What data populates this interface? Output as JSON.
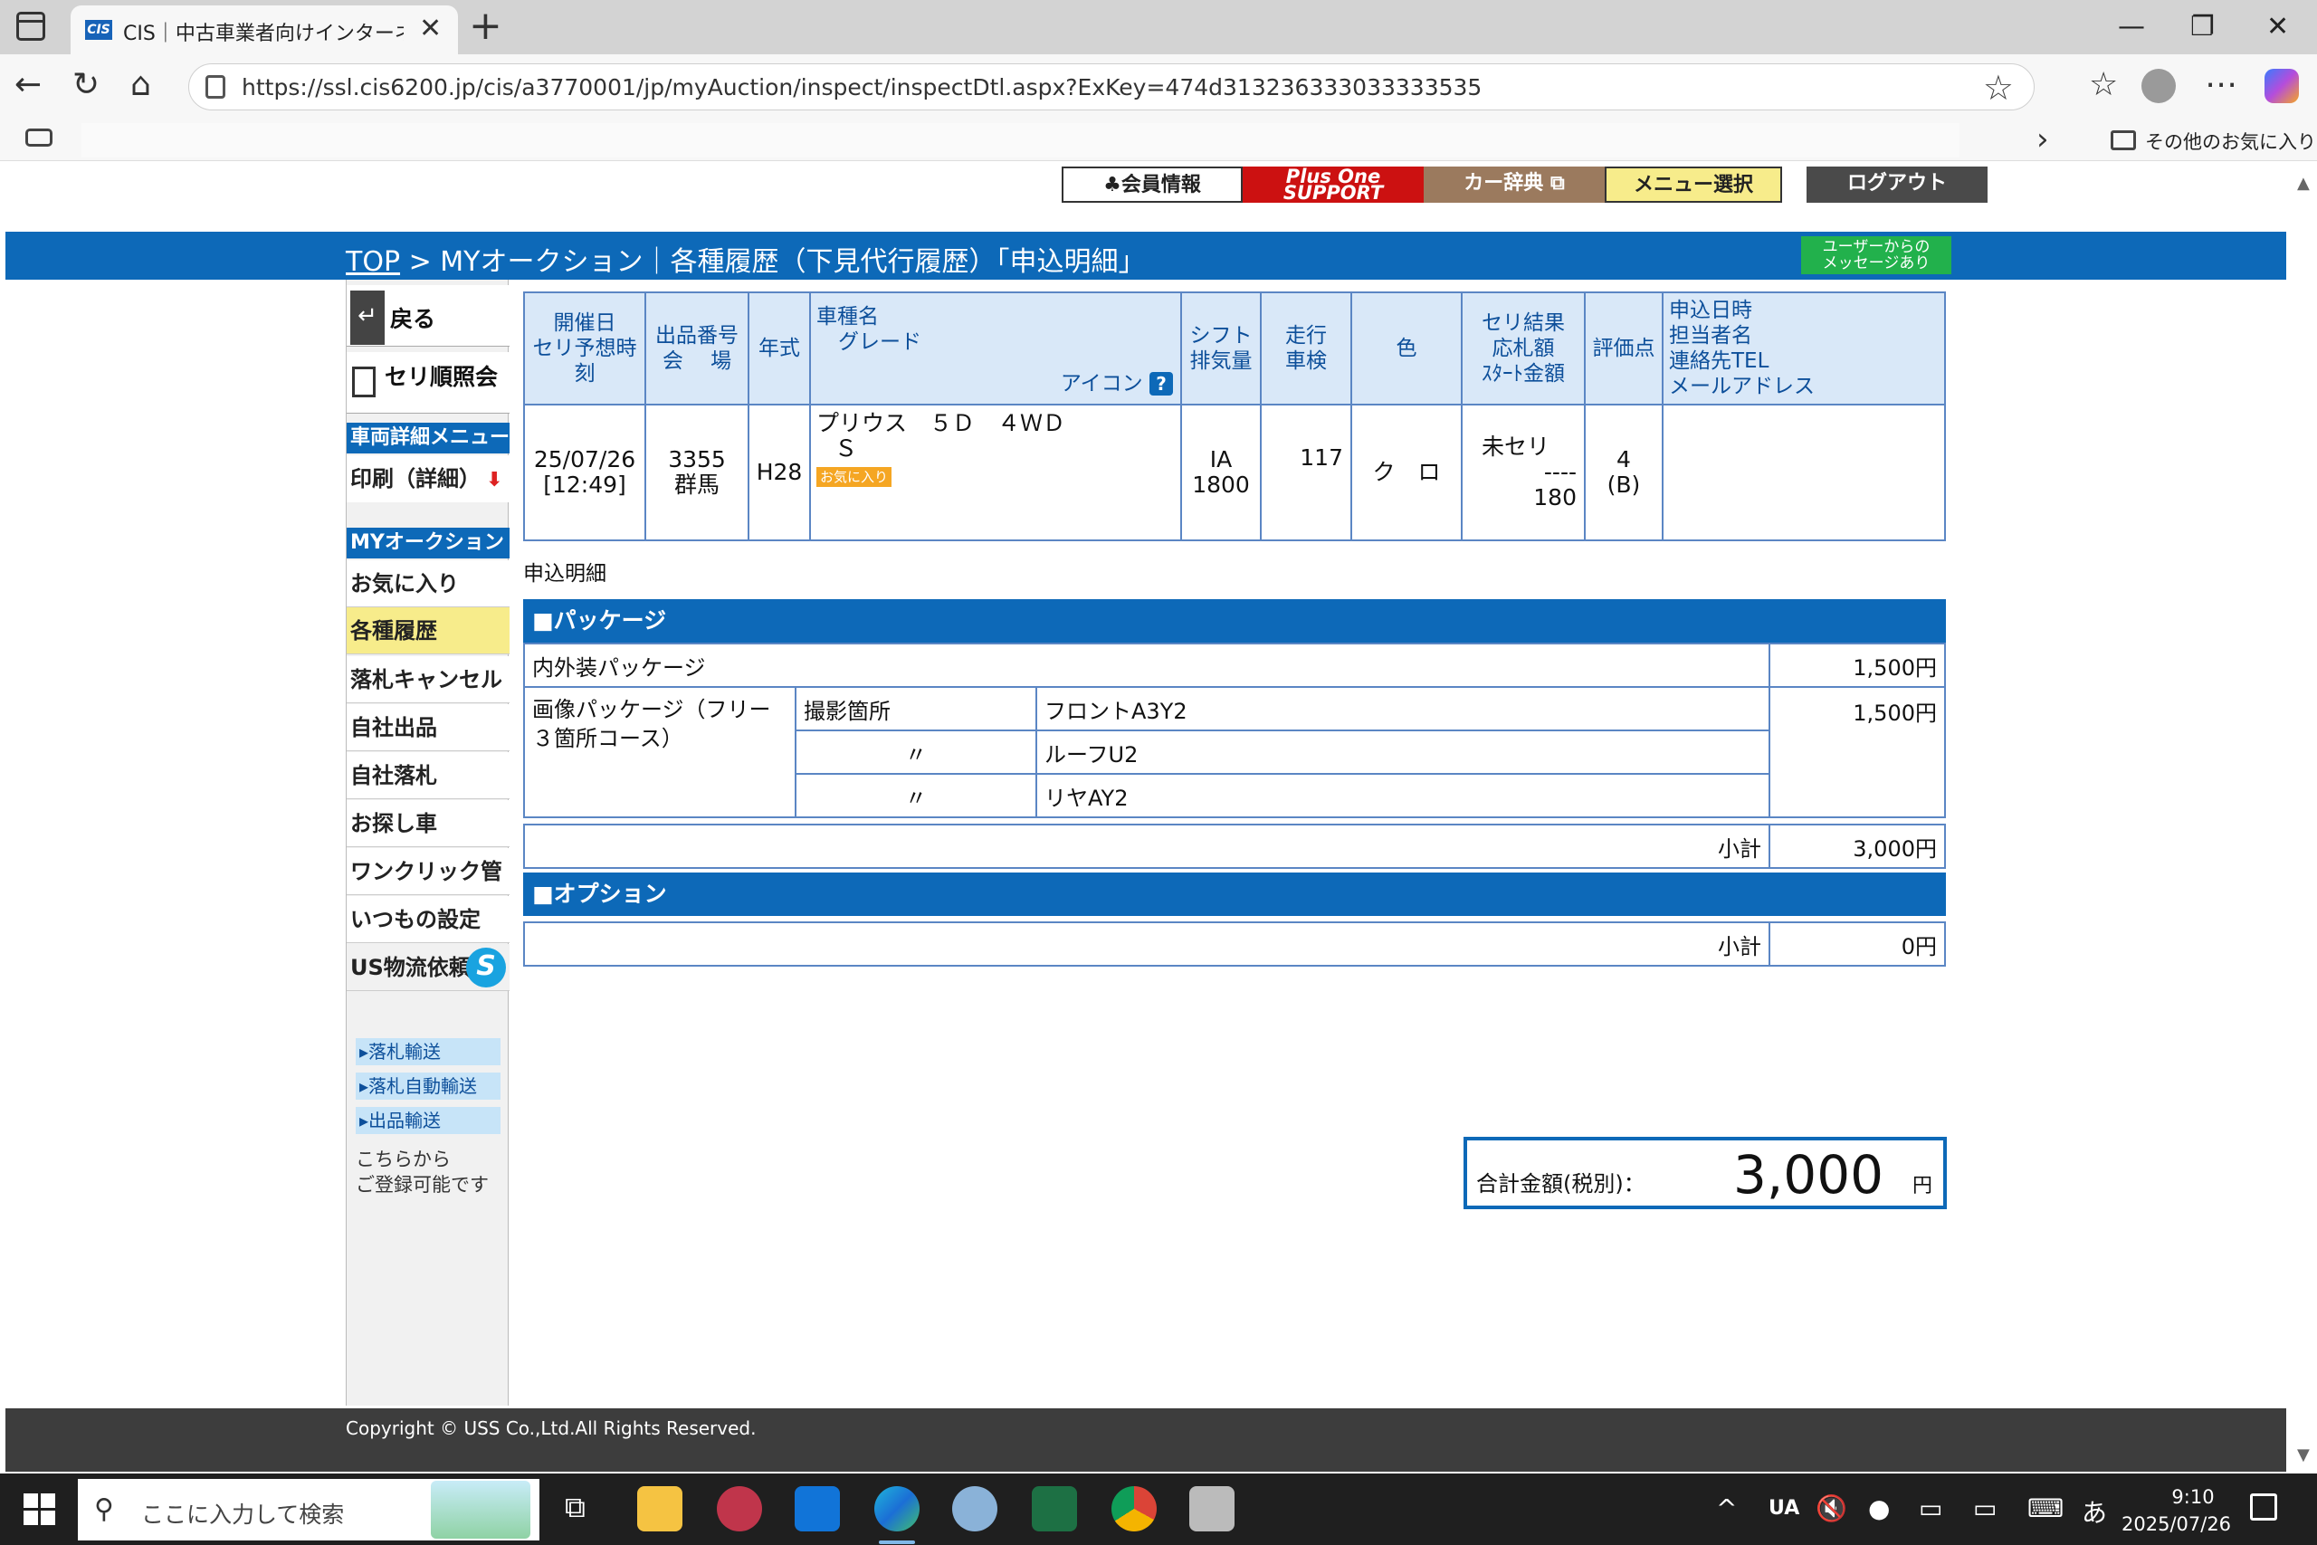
{
  "browser": {
    "tab_favicon": "CIS",
    "tab_title": "CIS｜中古車業者向けインターネット",
    "tab_close": "✕",
    "new_tab": "+",
    "url": "https://ssl.cis6200.jp/cis/a3770001/jp/myAuction/inspect/inspectDtl.aspx?ExKey=474d313236333033333535",
    "favorites_other": "その他のお気に入り",
    "icons": [
      "back-icon",
      "refresh-icon",
      "home-icon",
      "lock-icon",
      "star-icon",
      "favorites-icon",
      "profile-icon",
      "more-icon",
      "copilot-icon",
      "minimize-icon",
      "restore-icon",
      "close-icon"
    ]
  },
  "header": {
    "buttons": {
      "member": "会員情報",
      "plusone": "Plus One SUPPORT",
      "cardict": "カー辞典",
      "menu": "メニュー選択",
      "logout": "ログアウト"
    },
    "breadcrumb_top": "TOP",
    "breadcrumb_rest": " > MYオークション｜各種履歴（下見代行履歴）「申込明細」",
    "user_message": "ユーザーからの\nメッセージあり"
  },
  "sidebar": {
    "back": "戻る",
    "seri": "セリ順照会",
    "vehicle_menu_head": "車両詳細メニュー",
    "print": "印刷（詳細）",
    "myauction_head": "MYオークション",
    "items": [
      "お気に入り",
      "各種履歴",
      "落札キャンセル",
      "自社出品",
      "自社落札",
      "お探し車",
      "ワンクリック管理",
      "いつもの設定",
      "US物流依頼"
    ],
    "sub_items": [
      "落札輸送",
      "落札自動輸送",
      "出品輸送"
    ],
    "reg_note_1": "こちらから",
    "reg_note_2": "ご登録可能です"
  },
  "car_table": {
    "headers": {
      "date_1": "開催日",
      "date_2": "セリ予想時刻",
      "lot_1": "出品番号",
      "lot_2": "会　 場",
      "year": "年式",
      "name_1": "車種名",
      "name_2": "グレード",
      "icon": "アイコン",
      "shift_1": "シフト",
      "shift_2": "排気量",
      "mileage_1": "走行",
      "mileage_2": "車検",
      "color": "色",
      "result_1": "セリ結果",
      "result_2": "応札額",
      "result_3": "ｽﾀｰﾄ金額",
      "score": "評価点",
      "apply_1": "申込日時",
      "apply_2": "担当者名",
      "apply_3": "連絡先TEL",
      "apply_4": "メールアドレス"
    },
    "row": {
      "date": "25/07/26",
      "time": "[12:49]",
      "lot": "3355",
      "venue": "群馬",
      "year": "H28",
      "name": "プリウス　５Ｄ　４ＷＤ",
      "grade": "Ｓ",
      "fav_badge": "お気に入り",
      "shift": "IA",
      "displacement": "1800",
      "mileage": "117",
      "color": "ク　ロ",
      "result": "未セリ",
      "bid": "----",
      "start_price": "180",
      "score": "4",
      "score_sub": "(B)"
    }
  },
  "detail": {
    "label": "申込明細",
    "package_head": "■パッケージ",
    "interior_exterior": "内外装パッケージ",
    "interior_exterior_price": "1,500円",
    "image_package": "画像パッケージ（フリー３箇所コース）",
    "shoot_label": "撮影箇所",
    "ditto": "〃",
    "shoot_1": "フロントA3Y2",
    "shoot_2": "ルーフU2",
    "shoot_3": "リヤAY2",
    "image_package_price": "1,500円",
    "subtotal_label": "小計",
    "package_subtotal": "3,000円",
    "option_head": "■オプション",
    "option_subtotal": "0円",
    "total_label": "合計金額(税別)：",
    "total_value": "3,000",
    "total_unit": "円"
  },
  "footer": {
    "copyright": "Copyright © USS Co.,Ltd.All Rights Reserved."
  },
  "taskbar": {
    "search_placeholder": "ここに入力して検索",
    "time": "9:10",
    "date": "2025/07/26",
    "ime": "あ",
    "ua": "UA"
  }
}
